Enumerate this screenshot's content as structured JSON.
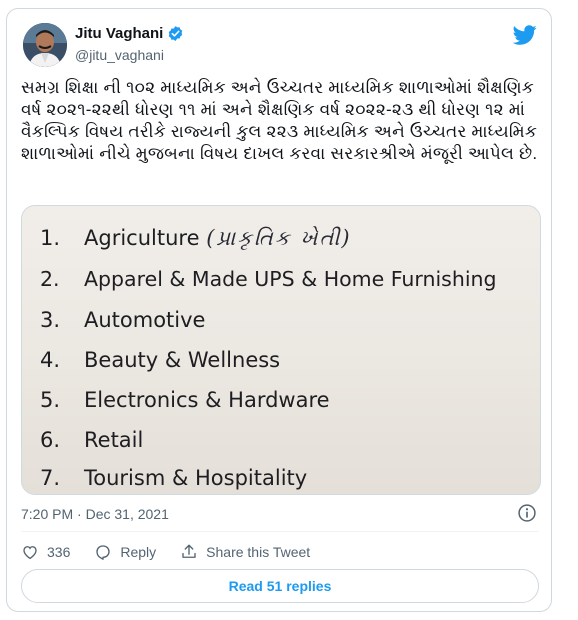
{
  "author": {
    "display_name": "Jitu Vaghani",
    "handle": "@jitu_vaghani",
    "verified": true
  },
  "tweet": {
    "text": "સમગ્ર શિક્ષા ની ૧૦૨ માધ્યમિક અને ઉચ્ચતર માધ્યમિક શાળાઓમાં શૈક્ષણિક વર્ષ ૨૦૨૧-૨૨થી ધોરણ ૧૧ માં અને શૈક્ષણિક વર્ષ ૨૦૨૨-૨૩ થી ધોરણ ૧૨ માં વૈકલ્પિક વિષય તરીકે રાજ્યની કુલ ૨૨૩ માધ્યમિક અને ઉચ્ચતર માધ્યમિક શાળાઓમાં નીચે મુજબના વિષય દાખલ કરવા સરકારશ્રીએ મંજૂરી આપેલ છે.",
    "timestamp": "7:20 PM · Dec 31, 2021"
  },
  "media": {
    "items": [
      {
        "num": "1.",
        "label": "Agriculture",
        "note": "(પ્રાકૃતિક ખેતી)"
      },
      {
        "num": "2.",
        "label": "Apparel & Made UPS & Home Furnishing"
      },
      {
        "num": "3.",
        "label": "Automotive"
      },
      {
        "num": "4.",
        "label": "Beauty & Wellness"
      },
      {
        "num": "5.",
        "label": "Electronics & Hardware"
      },
      {
        "num": "6.",
        "label": "Retail"
      },
      {
        "num": "7.",
        "label": "Tourism & Hospitality"
      }
    ]
  },
  "actions": {
    "like_count": "336",
    "reply_label": "Reply",
    "share_label": "Share this Tweet"
  },
  "replies_button": "Read 51 replies",
  "colors": {
    "accent": "#1d9bf0",
    "text": "#0f1419",
    "muted": "#536471",
    "border": "#cfd9de"
  }
}
